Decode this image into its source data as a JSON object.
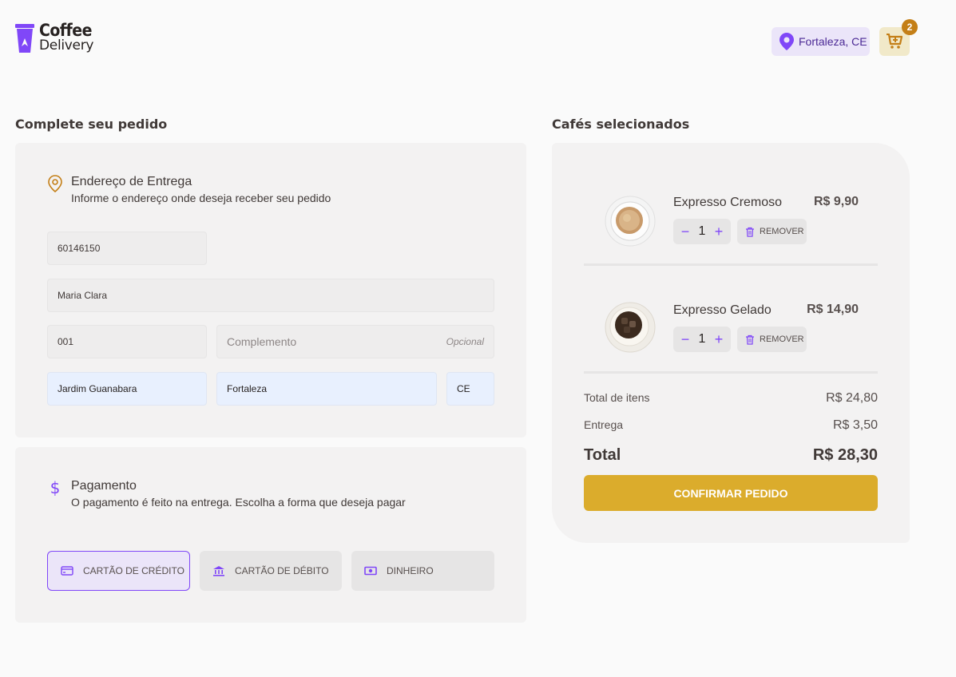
{
  "brand": {
    "line1": "Coffee",
    "line2": "Delivery",
    "accent_purple": "#8047f8",
    "accent_yellow": "#dbac2c",
    "accent_orange": "#c47f17"
  },
  "header": {
    "location": "Fortaleza, CE",
    "cart_count": "2"
  },
  "checkout": {
    "title": "Complete seu pedido",
    "address": {
      "heading": "Endereço de Entrega",
      "subheading": "Informe o endereço onde deseja receber seu pedido",
      "cep": "60146150",
      "rua": "Maria Clara",
      "numero": "001",
      "complemento_placeholder": "Complemento",
      "complemento_optional": "Opcional",
      "bairro": "Jardim Guanabara",
      "cidade": "Fortaleza",
      "uf": "CE"
    },
    "payment": {
      "heading": "Pagamento",
      "subheading": "O pagamento é feito na entrega. Escolha a forma que deseja pagar",
      "options": [
        {
          "label": "CARTÃO DE CRÉDITO",
          "icon": "credit-card-icon",
          "selected": true
        },
        {
          "label": "CARTÃO DE DÉBITO",
          "icon": "bank-icon",
          "selected": false
        },
        {
          "label": "DINHEIRO",
          "icon": "money-icon",
          "selected": false
        }
      ]
    }
  },
  "cart": {
    "title": "Cafés selecionados",
    "items": [
      {
        "name": "Expresso Cremoso",
        "price": "R$ 9,90",
        "qty": "1",
        "remove": "REMOVER",
        "image": "coffee-cremoso"
      },
      {
        "name": "Expresso Gelado",
        "price": "R$ 14,90",
        "qty": "1",
        "remove": "REMOVER",
        "image": "coffee-gelado"
      }
    ],
    "summary": {
      "items_label": "Total de itens",
      "items_value": "R$ 24,80",
      "delivery_label": "Entrega",
      "delivery_value": "R$ 3,50",
      "total_label": "Total",
      "total_value": "R$ 28,30"
    },
    "confirm_label": "CONFIRMAR PEDIDO"
  }
}
